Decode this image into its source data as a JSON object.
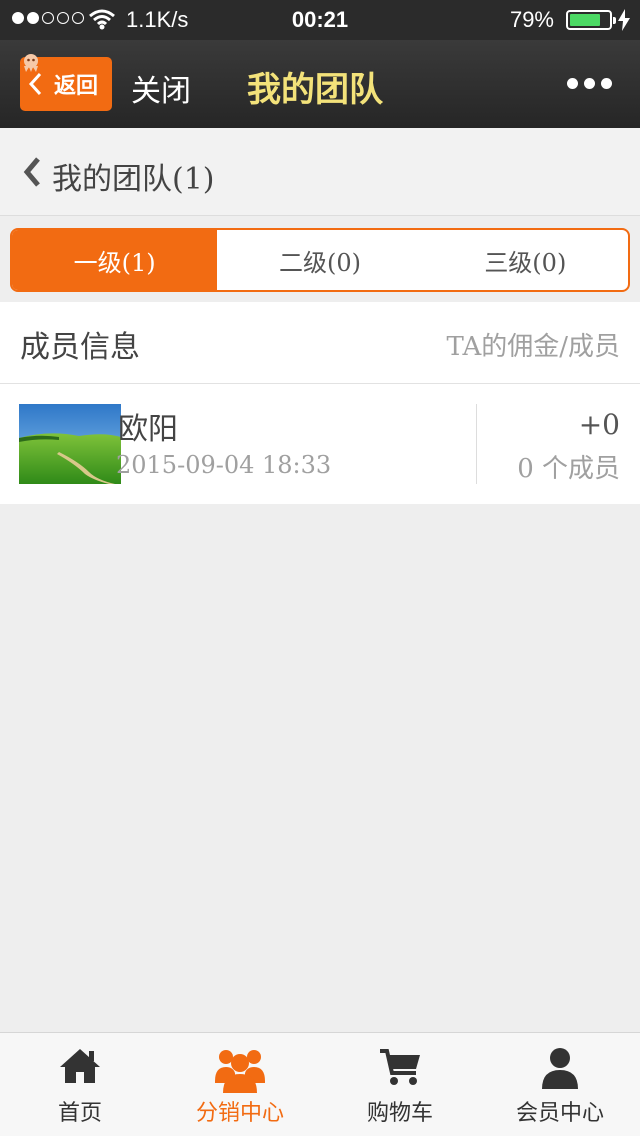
{
  "status_bar": {
    "speed": "1.1K/s",
    "time": "00:21",
    "battery": "79%",
    "battery_level": 0.79
  },
  "nav": {
    "back_label": "返回",
    "close_label": "关闭",
    "title": "我的团队"
  },
  "sub_header": {
    "title": "我的团队(1)"
  },
  "tabs": [
    {
      "label": "一级(1)",
      "active": true
    },
    {
      "label": "二级(0)",
      "active": false
    },
    {
      "label": "三级(0)",
      "active": false
    }
  ],
  "members_header": {
    "left": "成员信息",
    "right": "TA的佣金/成员"
  },
  "members": [
    {
      "name": "欧阳",
      "date": "2015-09-04 18:33",
      "commission": "+0",
      "count": "0 个成员"
    }
  ],
  "bottom_nav": [
    {
      "label": "首页",
      "icon": "home-icon",
      "active": false
    },
    {
      "label": "分销中心",
      "icon": "users-icon",
      "active": true
    },
    {
      "label": "购物车",
      "icon": "cart-icon",
      "active": false
    },
    {
      "label": "会员中心",
      "icon": "user-icon",
      "active": false
    }
  ],
  "colors": {
    "accent": "#f26b12",
    "nav_title": "#f3e27a"
  }
}
